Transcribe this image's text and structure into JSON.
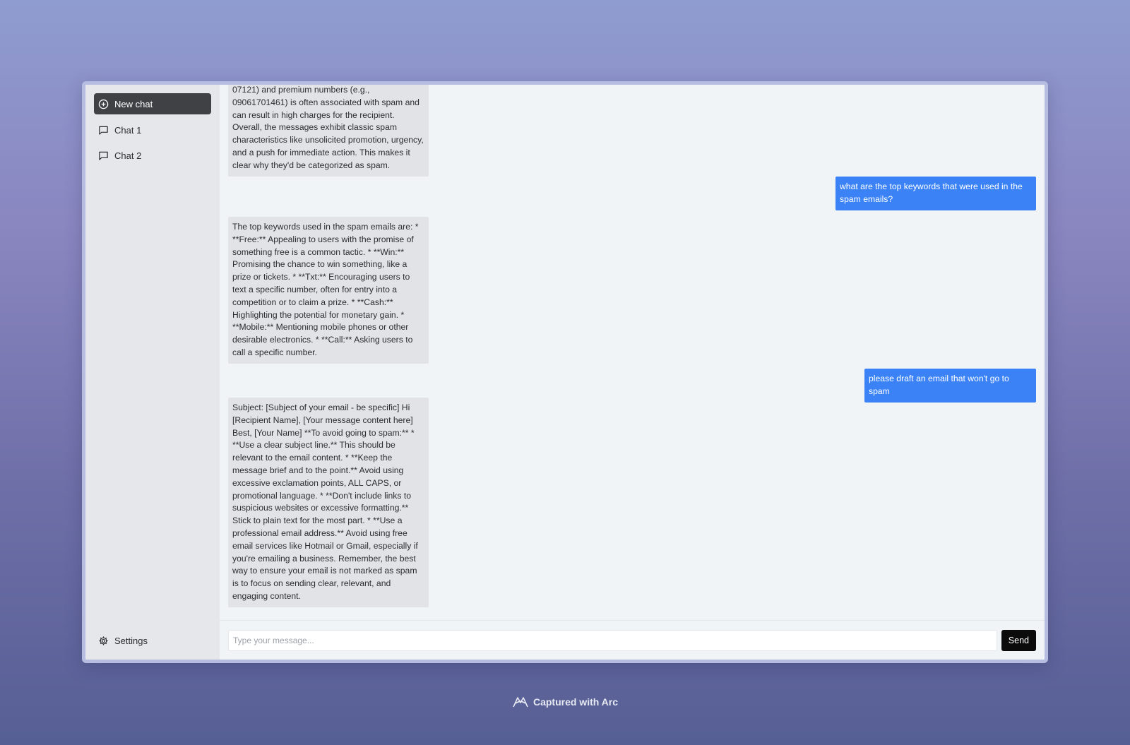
{
  "sidebar": {
    "new_chat_label": "New chat",
    "chats": [
      {
        "label": "Chat 1"
      },
      {
        "label": "Chat 2"
      }
    ],
    "settings_label": "Settings"
  },
  "messages": [
    {
      "role": "bot",
      "text": "07121) and premium numbers (e.g., 09061701461) is often associated with spam and can result in high charges for the recipient. Overall, the messages exhibit classic spam characteristics like unsolicited promotion, urgency, and a push for immediate action. This makes it clear why they'd be categorized as spam."
    },
    {
      "role": "user",
      "text": "what are the top keywords that were used in the spam emails?"
    },
    {
      "role": "bot",
      "text": "The top keywords used in the spam emails are: * **Free:** Appealing to users with the promise of something free is a common tactic. * **Win:** Promising the chance to win something, like a prize or tickets. * **Txt:** Encouraging users to text a specific number, often for entry into a competition or to claim a prize. * **Cash:** Highlighting the potential for monetary gain. * **Mobile:** Mentioning mobile phones or other desirable electronics. * **Call:** Asking users to call a specific number."
    },
    {
      "role": "user",
      "text": "please draft an email that won't go to spam"
    },
    {
      "role": "bot",
      "text": "Subject: [Subject of your email - be specific] Hi [Recipient Name], [Your message content here] Best, [Your Name] **To avoid going to spam:** * **Use a clear subject line.** This should be relevant to the email content. * **Keep the message brief and to the point.** Avoid using excessive exclamation points, ALL CAPS, or promotional language. * **Don't include links to suspicious websites or excessive formatting.** Stick to plain text for the most part. * **Use a professional email address.** Avoid using free email services like Hotmail or Gmail, especially if you're emailing a business. Remember, the best way to ensure your email is not marked as spam is to focus on sending clear, relevant, and engaging content."
    }
  ],
  "composer": {
    "placeholder": "Type your message...",
    "send_label": "Send"
  },
  "footer": {
    "label": "Captured with Arc"
  }
}
